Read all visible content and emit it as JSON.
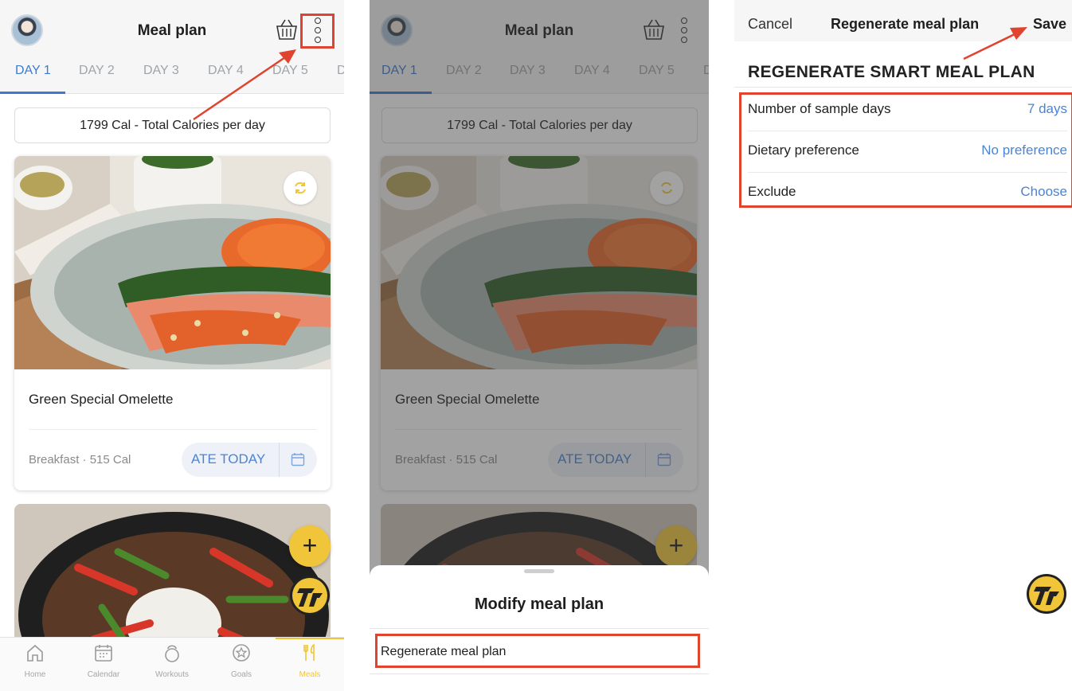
{
  "screen1": {
    "header": {
      "title": "Meal plan",
      "avatar_icon": "user-avatar",
      "basket_icon": "shopping-basket-icon",
      "more_icon": "kebab-menu-icon"
    },
    "tabs": [
      "DAY 1",
      "DAY 2",
      "DAY 3",
      "DAY 4",
      "DAY 5",
      "D"
    ],
    "active_tab": "DAY 1",
    "calories_summary": "1799 Cal - Total Calories per day",
    "meal": {
      "name": "Green Special Omelette",
      "meta": "Breakfast · 515 Cal",
      "ate_today_label": "ATE TODAY",
      "refresh_icon": "refresh-icon",
      "calendar_icon": "calendar-icon"
    },
    "fab_label": "+",
    "bottom_nav": [
      {
        "label": "Home",
        "icon": "home-icon"
      },
      {
        "label": "Calendar",
        "icon": "calendar-icon"
      },
      {
        "label": "Workouts",
        "icon": "kettlebell-icon"
      },
      {
        "label": "Goals",
        "icon": "goals-icon"
      },
      {
        "label": "Meals",
        "icon": "fork-knife-icon"
      }
    ],
    "active_nav": "Meals"
  },
  "screen2": {
    "header": {
      "title": "Meal plan"
    },
    "tabs": [
      "DAY 1",
      "DAY 2",
      "DAY 3",
      "DAY 4",
      "DAY 5",
      "D"
    ],
    "calories_summary": "1799 Cal - Total Calories per day",
    "meal": {
      "name": "Green Special Omelette",
      "meta": "Breakfast · 515 Cal",
      "ate_today_label": "ATE TODAY"
    },
    "fab_label": "+",
    "sheet": {
      "title": "Modify meal plan",
      "items": [
        "Regenerate meal plan"
      ]
    }
  },
  "screen3": {
    "nav": {
      "cancel": "Cancel",
      "title": "Regenerate meal plan",
      "save": "Save"
    },
    "heading": "REGENERATE SMART MEAL PLAN",
    "rows": [
      {
        "label": "Number of sample days",
        "value": "7 days"
      },
      {
        "label": "Dietary preference",
        "value": "No preference"
      },
      {
        "label": "Exclude",
        "value": "Choose"
      }
    ]
  },
  "colors": {
    "accent_blue": "#3d7bd3",
    "fab_yellow": "#f1c53a",
    "annotation_red": "#e0432e"
  }
}
